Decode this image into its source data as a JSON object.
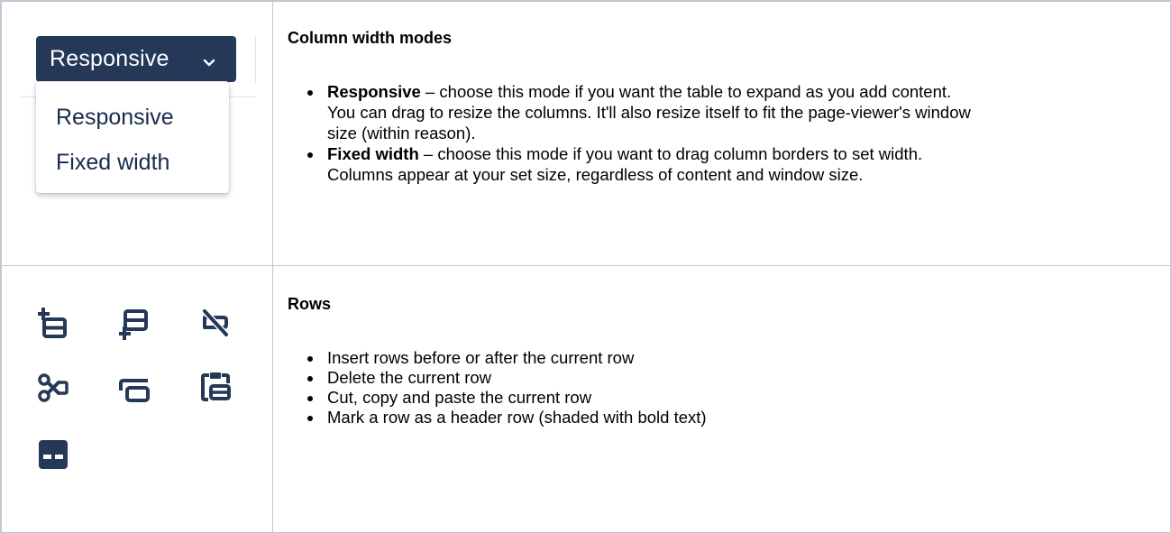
{
  "dropdown": {
    "button_label": "Responsive",
    "chevron_icon": "chevron-down-icon",
    "options": [
      "Responsive",
      "Fixed width"
    ]
  },
  "column_modes": {
    "heading": "Column width modes",
    "items": [
      {
        "term": "Responsive",
        "text": " – choose this mode if you want the table to expand as you add content. You can drag to resize the columns. It'll also resize itself to fit the page-viewer's window size (within reason)."
      },
      {
        "term": "Fixed width",
        "text": " – choose this mode if you want to drag column borders to set width. Columns appear at your set size, regardless of content and window size."
      }
    ]
  },
  "rows": {
    "heading": "Rows",
    "icons": [
      "insert-row-before-icon",
      "insert-row-after-icon",
      "delete-row-icon",
      "cut-row-icon",
      "copy-row-icon",
      "paste-row-icon",
      "header-row-icon"
    ],
    "items": [
      "Insert rows before or after the current row",
      "Delete the current row",
      "Cut, copy and paste the current row",
      "Mark a row as a header row (shaded with bold text)"
    ]
  },
  "colors": {
    "dropdown_bg": "#253858",
    "icon_color": "#253858",
    "border": "#c1c7d0"
  }
}
